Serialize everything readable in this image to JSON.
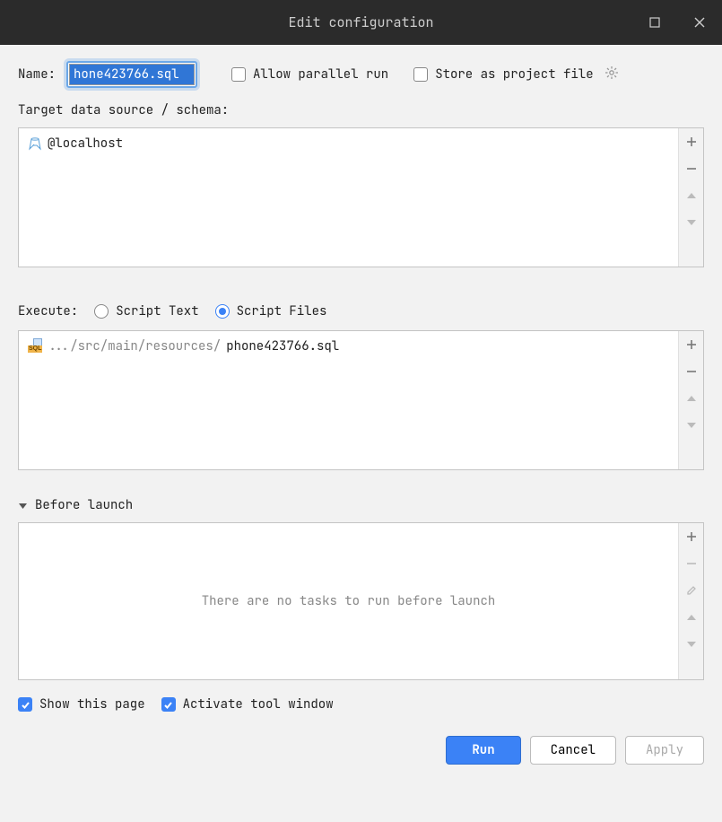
{
  "title": "Edit configuration",
  "name_label": "Name:",
  "name_value": "hone423766.sql",
  "allow_parallel_label": "Allow parallel run",
  "allow_parallel_checked": false,
  "store_project_label": "Store as project file",
  "store_project_checked": false,
  "target_label": "Target data source / schema:",
  "datasource": "@localhost",
  "execute_label": "Execute:",
  "radio_script_text": "Script Text",
  "radio_script_files": "Script Files",
  "execute_mode": "files",
  "script_file_dir": ".../src/main/resources/",
  "script_file_name": "phone423766.sql",
  "before_launch_label": "Before launch",
  "before_launch_empty": "There are no tasks to run before launch",
  "show_page_label": "Show this page",
  "show_page_checked": true,
  "activate_tool_label": "Activate tool window",
  "activate_tool_checked": true,
  "run_label": "Run",
  "cancel_label": "Cancel",
  "apply_label": "Apply"
}
